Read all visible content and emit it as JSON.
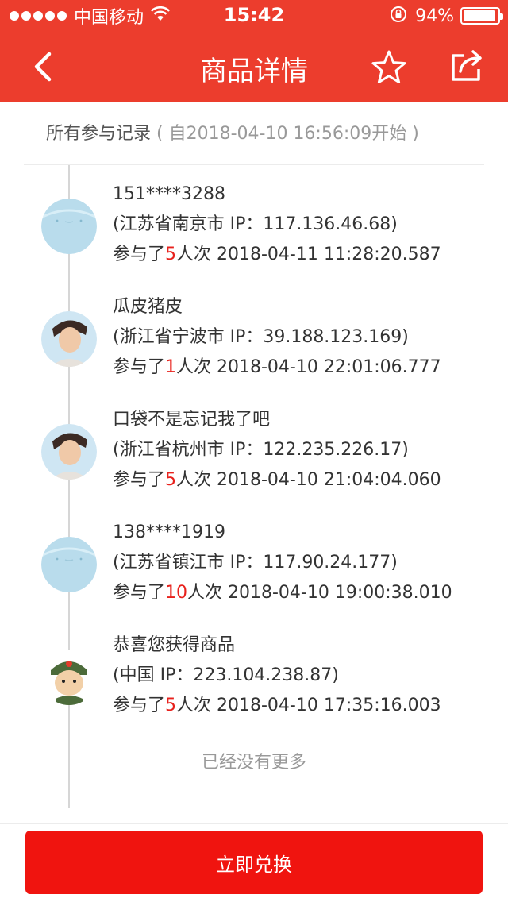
{
  "status_bar": {
    "carrier": "中国移动",
    "time": "15:42",
    "battery_percent": "94%",
    "battery_level": 0.94
  },
  "nav": {
    "title": "商品详情",
    "back_icon": "chevron-left-icon",
    "star_icon": "star-icon",
    "share_icon": "share-icon"
  },
  "records_header": {
    "title": "所有参与记录",
    "since": "( 自2018-04-10 16:56:09开始 )"
  },
  "records": [
    {
      "name": "151****3288",
      "location": "(江苏省南京市 IP：117.136.46.68)",
      "prefix": "参与了",
      "count": "5",
      "suffix": "人次 2018-04-11 11:28:20.587",
      "avatar": "default-avatar"
    },
    {
      "name": "瓜皮猪皮",
      "location": "(浙江省宁波市 IP：39.188.123.169)",
      "prefix": "参与了",
      "count": "1",
      "suffix": "人次 2018-04-10 22:01:06.777",
      "avatar": "photo-avatar"
    },
    {
      "name": "口袋不是忘记我了吧",
      "location": "(浙江省杭州市 IP：122.235.226.17)",
      "prefix": "参与了",
      "count": "5",
      "suffix": "人次 2018-04-10 21:04:04.060",
      "avatar": "photo-avatar"
    },
    {
      "name": "138****1919",
      "location": "(江苏省镇江市 IP：117.90.24.177)",
      "prefix": "参与了",
      "count": "10",
      "suffix": "人次 2018-04-10 19:00:38.010",
      "avatar": "default-avatar"
    },
    {
      "name": "恭喜您获得商品",
      "location": "(中国 IP：223.104.238.87)",
      "prefix": "参与了",
      "count": "5",
      "suffix": "人次 2018-04-10 17:35:16.003",
      "avatar": "soldier-avatar"
    }
  ],
  "no_more_text": "已经没有更多",
  "redeem_button": "立即兑换",
  "colors": {
    "brand_red": "#ec3d2d",
    "button_red": "#f0140f",
    "count_red": "#e8211c"
  }
}
